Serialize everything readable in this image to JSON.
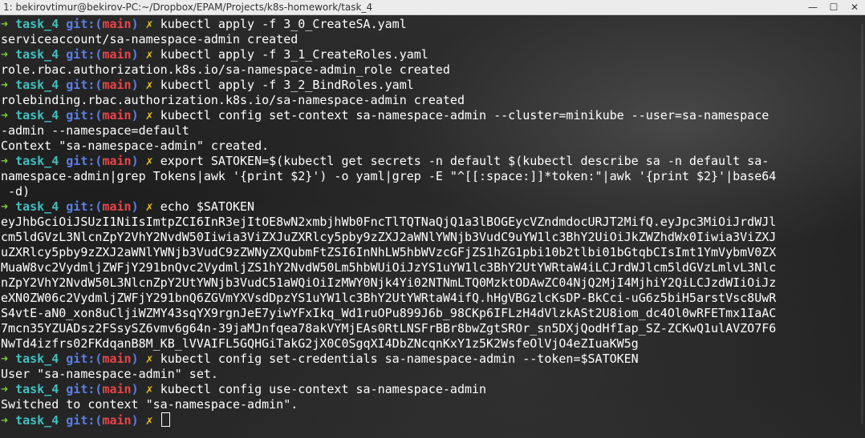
{
  "window": {
    "title": "1: bekirovtimur@bekirov-PC:~/Dropbox/EPAM/Projects/k8s-homework/task_4",
    "minimize_glyph": "—",
    "maximize_glyph": "☐",
    "close_glyph": "✕"
  },
  "prompt": {
    "arrow": "➜",
    "dir": "task_4",
    "git_label": "git:(",
    "branch": "main",
    "git_close": ")",
    "dirty": "✗"
  },
  "lines": [
    {
      "type": "prompt",
      "command": "kubectl apply -f 3_0_CreateSA.yaml"
    },
    {
      "type": "output",
      "text": "serviceaccount/sa-namespace-admin created"
    },
    {
      "type": "prompt",
      "command": "kubectl apply -f 3_1_CreateRoles.yaml"
    },
    {
      "type": "output",
      "text": "role.rbac.authorization.k8s.io/sa-namespace-admin_role created"
    },
    {
      "type": "prompt",
      "command": "kubectl apply -f 3_2_BindRoles.yaml"
    },
    {
      "type": "output",
      "text": "rolebinding.rbac.authorization.k8s.io/sa-namespace-admin created"
    },
    {
      "type": "prompt",
      "command": "kubectl config set-context sa-namespace-admin --cluster=minikube --user=sa-namespace"
    },
    {
      "type": "output",
      "text": "-admin --namespace=default"
    },
    {
      "type": "output",
      "text": "Context \"sa-namespace-admin\" created."
    },
    {
      "type": "prompt",
      "command": "export SATOKEN=$(kubectl get secrets -n default $(kubectl describe sa -n default sa-"
    },
    {
      "type": "output",
      "text": "namespace-admin|grep Tokens|awk '{print $2}') -o yaml|grep -E \"^[[:space:]]*token:\"|awk '{print $2}'|base64"
    },
    {
      "type": "output",
      "text": " -d)"
    },
    {
      "type": "prompt",
      "command": "echo $SATOKEN"
    },
    {
      "type": "output",
      "text": "eyJhbGciOiJSUzI1NiIsImtpZCI6InR3ejItOE8wN2xmbjhWb0FncTlTQTNaQjQ1a3lBOGEycVZndmdocURJT2MifQ.eyJpc3MiOiJrdWJl"
    },
    {
      "type": "output",
      "text": "cm5ldGVzL3NlcnZpY2VhY2NvdW50Iiwia3ViZXJuZXRlcy5pby9zZXJ2aWNlYWNjb3VudC9uYW1lc3BhY2UiOiJkZWZhdWx0Iiwia3ViZXJ"
    },
    {
      "type": "output",
      "text": "uZXRlcy5pby9zZXJ2aWNlYWNjb3VudC9zZWNyZXQubmFtZSI6InNhLW5hbWVzcGFjZS1hZG1pbi10b2tlbi01bGtqbCIsImt1YmVybmV0ZX"
    },
    {
      "type": "output",
      "text": "MuaW8vc2VydmljZWFjY291bnQvc2VydmljZS1hY2NvdW50Lm5hbWUiOiJzYS1uYW1lc3BhY2UtYWRtaW4iLCJrdWJlcm5ldGVzLmlvL3Nlc"
    },
    {
      "type": "output",
      "text": "nZpY2VhY2NvdW50L3NlcnZpY2UtYWNjb3VudC51aWQiOiIzMWY0Njk4Yi02NTNmLTQ0MzktODAwZC04NjQ2MjI4MjhiY2QiLCJzdWIiOiJz"
    },
    {
      "type": "output",
      "text": "eXN0ZW06c2VydmljZWFjY291bnQ6ZGVmYXVsdDpzYS1uYW1lc3BhY2UtYWRtaW4ifQ.hHgVBGzlcKsDP-BkCci-uG6z5biH5arstVsc8UwR"
    },
    {
      "type": "output",
      "text": "S4vtE-aN0_xon8uCljiWZMY43sqYX9rgnJeE7yiwYFxIkq_Wd1ruOPu899J6b_98CKp6IFLzH4dVlzkASt2U8iom_dc4Ol0wRFETmx1IaAC"
    },
    {
      "type": "output",
      "text": "7mcn35YZUADsz2FSsySZ6vmv6g64n-39jaMJnfqea78akVYMjEAs0RtLNSFrBBr8bwZgtSROr_sn5DXjQodHfIap_SZ-ZCKwQ1ulAVZO7F6"
    },
    {
      "type": "output",
      "text": "NwTd4izfrs02FKdqanB8M_KB_lVVAIFL5GQHGiTakG2jX0C0SgqXI4DbZNcqnKxY1z5K2WsfeOlVjO4eZIuaKW5g"
    },
    {
      "type": "prompt",
      "command": "kubectl config set-credentials sa-namespace-admin --token=$SATOKEN"
    },
    {
      "type": "output",
      "text": "User \"sa-namespace-admin\" set."
    },
    {
      "type": "prompt",
      "command": "kubectl config use-context sa-namespace-admin"
    },
    {
      "type": "output",
      "text": "Switched to context \"sa-namespace-admin\"."
    },
    {
      "type": "prompt",
      "command": "",
      "cursor": true
    }
  ],
  "colors": {
    "arrow": "#7ec93a",
    "dir": "#40c0c0",
    "git": "#5b7fe8",
    "branch": "#e5464b",
    "dirty": "#e6c229",
    "text": "#ffffff"
  }
}
